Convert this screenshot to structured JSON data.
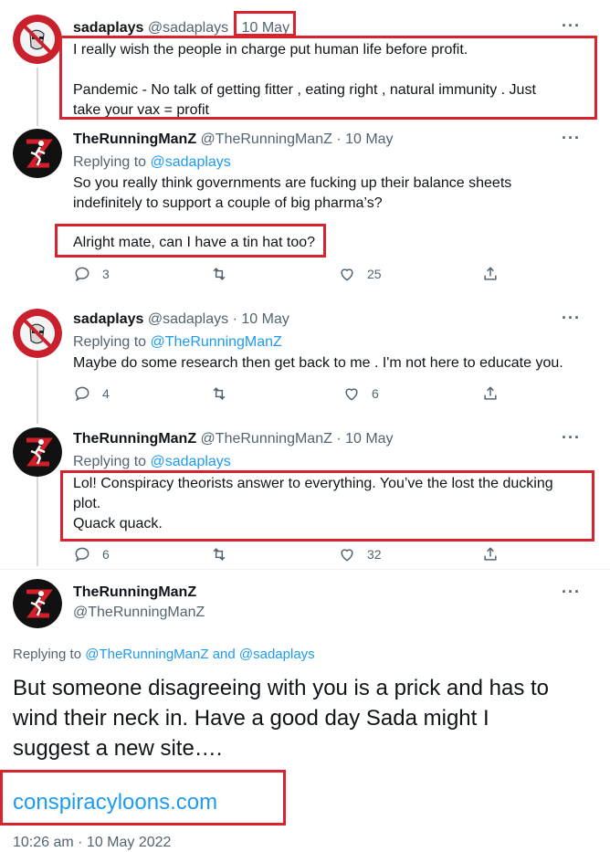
{
  "tweets": [
    {
      "display_name": "sadaplays",
      "handle": "@sadaplays",
      "date": "10 May",
      "text_lines": [
        "I really wish the people in charge put human life before profit.",
        "Pandemic - No talk of getting fitter , eating right , natural immunity . Just",
        "take your vax = profit"
      ]
    },
    {
      "display_name": "TheRunningManZ",
      "handle": "@TheRunningManZ",
      "date": "· 10 May",
      "replying_label": "Replying to",
      "replying_to": "@sadaplays",
      "text_lines": [
        "So you really think governments are fucking up their balance sheets",
        "indefinitely to support a couple of big pharma’s?",
        "Alright mate, can I have a tin hat too?"
      ],
      "replies": "3",
      "retweets": "",
      "likes": "25"
    },
    {
      "display_name": "sadaplays",
      "handle": "@sadaplays",
      "date": "· 10 May",
      "replying_label": "Replying to",
      "replying_to": "@TheRunningManZ",
      "text_lines": [
        "Maybe do some research then get back to me . I'm not here to educate you."
      ],
      "replies": "4",
      "retweets": "",
      "likes": "6"
    },
    {
      "display_name": "TheRunningManZ",
      "handle": "@TheRunningManZ",
      "date": "· 10 May",
      "replying_label": "Replying to",
      "replying_to": "@sadaplays",
      "text_lines": [
        "Lol! Conspiracy theorists answer to everything. You’ve the lost the ducking",
        "plot.",
        "Quack quack."
      ],
      "replies": "6",
      "retweets": "",
      "likes": "32"
    }
  ],
  "main_tweet": {
    "display_name": "TheRunningManZ",
    "handle": "@TheRunningManZ",
    "replying_label": "Replying to",
    "replying_to_1": "@TheRunningManZ",
    "replying_and": "and",
    "replying_to_2": "@sadaplays",
    "text_lines": [
      "But someone disagreeing with you is a prick and has to",
      "wind their neck in. Have a good day Sada might I",
      "suggest a new site…."
    ],
    "link": "conspiracyloons.com",
    "timestamp": "10:26 am · 10 May 2022"
  },
  "icons": {
    "more": "more-horizontal-icon",
    "reply": "reply-bubble-icon",
    "retweet": "retweet-icon",
    "like": "heart-icon",
    "share": "share-icon"
  },
  "colors": {
    "accent": "#1d9bf0",
    "highlight": "#d9232e",
    "muted": "#536471"
  }
}
